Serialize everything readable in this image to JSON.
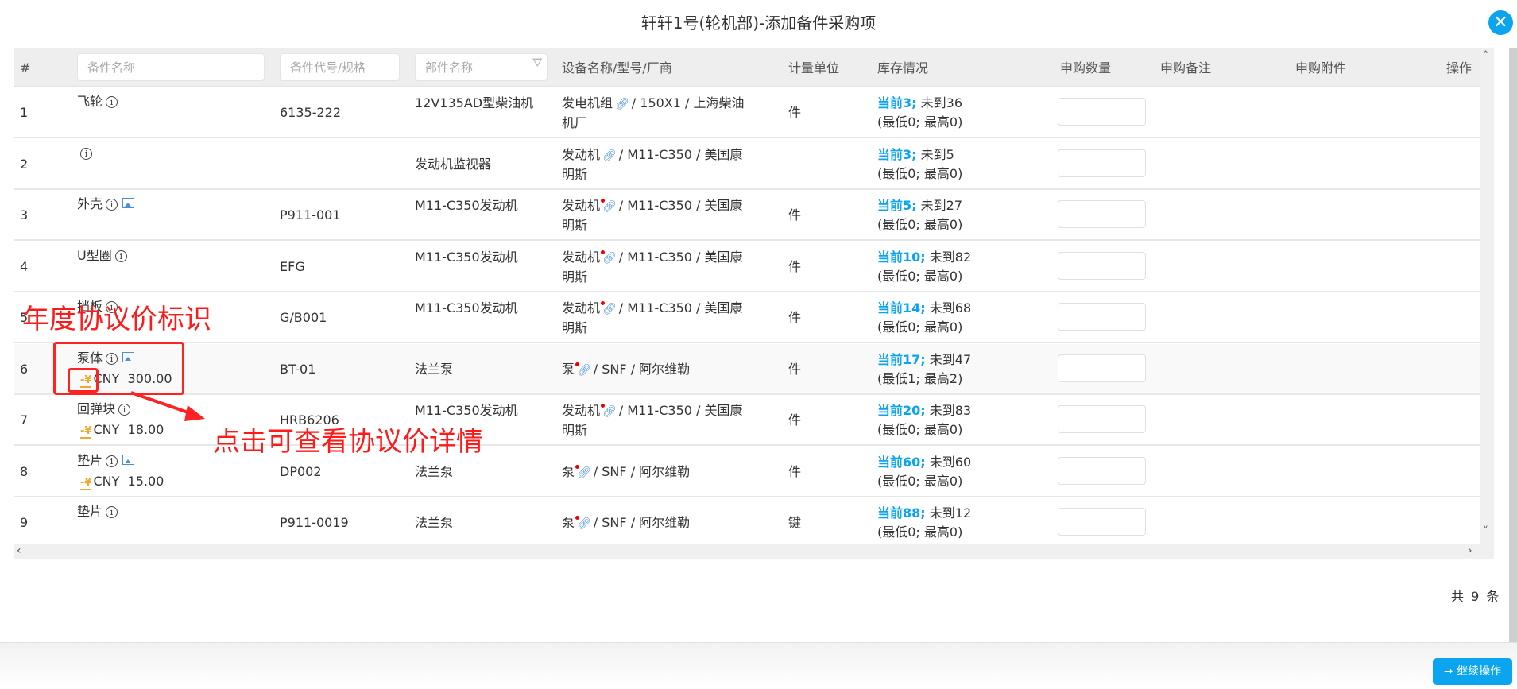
{
  "dialog": {
    "title": "轩轩1号(轮机部)-添加备件采购项",
    "close_icon": "close-icon"
  },
  "table": {
    "headers": {
      "index": "#",
      "equipment": "设备名称/型号/厂商",
      "unit": "计量单位",
      "stock": "库存情况",
      "qty": "申购数量",
      "remark": "申购备注",
      "attachment": "申购附件",
      "op": "操作"
    },
    "filters": {
      "name_placeholder": "备件名称",
      "code_placeholder": "备件代号/规格",
      "part_placeholder": "部件名称"
    },
    "rows": [
      {
        "index": "1",
        "name": "飞轮",
        "has_image": false,
        "price": "",
        "code": "6135-222",
        "part": "12V135AD型柴油机",
        "equip_name": "发电机组",
        "equip_rest": "/ 150X1 / 上海柴油机厂",
        "link_dot": false,
        "unit": "件",
        "current": "当前3;",
        "arrive": "未到36",
        "range": "(最低0; 最高0)"
      },
      {
        "index": "2",
        "name": "",
        "has_image": false,
        "price": "",
        "code": "",
        "part": "发动机监视器",
        "equip_name": "发动机",
        "equip_rest": "/ M11-C350 / 美国康明斯",
        "link_dot": false,
        "unit": "",
        "current": "当前3;",
        "arrive": "未到5",
        "range": "(最低0; 最高0)"
      },
      {
        "index": "3",
        "name": "外壳",
        "has_image": true,
        "price": "",
        "code": "P911-001",
        "part": "M11-C350发动机",
        "equip_name": "发动机",
        "equip_rest": "/ M11-C350 / 美国康明斯",
        "link_dot": true,
        "unit": "件",
        "current": "当前5;",
        "arrive": "未到27",
        "range": "(最低0; 最高0)"
      },
      {
        "index": "4",
        "name": "U型圈",
        "has_image": false,
        "price": "",
        "code": "EFG",
        "part": "M11-C350发动机",
        "equip_name": "发动机",
        "equip_rest": "/ M11-C350 / 美国康明斯",
        "link_dot": true,
        "unit": "件",
        "current": "当前10;",
        "arrive": "未到82",
        "range": "(最低0; 最高0)"
      },
      {
        "index": "5",
        "name": "挡板",
        "has_image": false,
        "price": "",
        "code": "G/B001",
        "part": "M11-C350发动机",
        "equip_name": "发动机",
        "equip_rest": "/ M11-C350 / 美国康明斯",
        "link_dot": true,
        "unit": "件",
        "current": "当前14;",
        "arrive": "未到68",
        "range": "(最低0; 最高0)"
      },
      {
        "index": "6",
        "name": "泵体",
        "has_image": true,
        "price": "CNY  300.00",
        "code": "BT-01",
        "part": "法兰泵",
        "equip_name": "泵",
        "equip_rest": "/ SNF / 阿尔维勒",
        "link_dot": true,
        "unit": "件",
        "current": "当前17;",
        "arrive": "未到47",
        "range": "(最低1; 最高2)"
      },
      {
        "index": "7",
        "name": "回弹块",
        "has_image": false,
        "price": "CNY  18.00",
        "code": "HRB6206",
        "part": "M11-C350发动机",
        "equip_name": "发动机",
        "equip_rest": "/ M11-C350 / 美国康明斯",
        "link_dot": true,
        "unit": "件",
        "current": "当前20;",
        "arrive": "未到83",
        "range": "(最低0; 最高0)"
      },
      {
        "index": "8",
        "name": "垫片",
        "has_image": true,
        "price": "CNY  15.00",
        "code": "DP002",
        "part": "法兰泵",
        "equip_name": "泵",
        "equip_rest": "/ SNF / 阿尔维勒",
        "link_dot": true,
        "unit": "件",
        "current": "当前60;",
        "arrive": "未到60",
        "range": "(最低0; 最高0)"
      },
      {
        "index": "9",
        "name": "垫片",
        "has_image": false,
        "price": "",
        "code": "P911-0019",
        "part": "法兰泵",
        "equip_name": "泵",
        "equip_rest": "/ SNF / 阿尔维勒",
        "link_dot": true,
        "unit": "键",
        "current": "当前88;",
        "arrive": "未到12",
        "range": "(最低0; 最高0)"
      }
    ],
    "highlighted_row": 6
  },
  "pagination": {
    "total": "共 9 条"
  },
  "footer": {
    "continue_label": "继续操作"
  },
  "annotations": {
    "label1": "年度协议价标识",
    "label2": "点击可查看协议价详情",
    "color": "#ff1a1a"
  },
  "colors": {
    "accent": "#0aa5ee",
    "price_icon": "#f0a830"
  }
}
